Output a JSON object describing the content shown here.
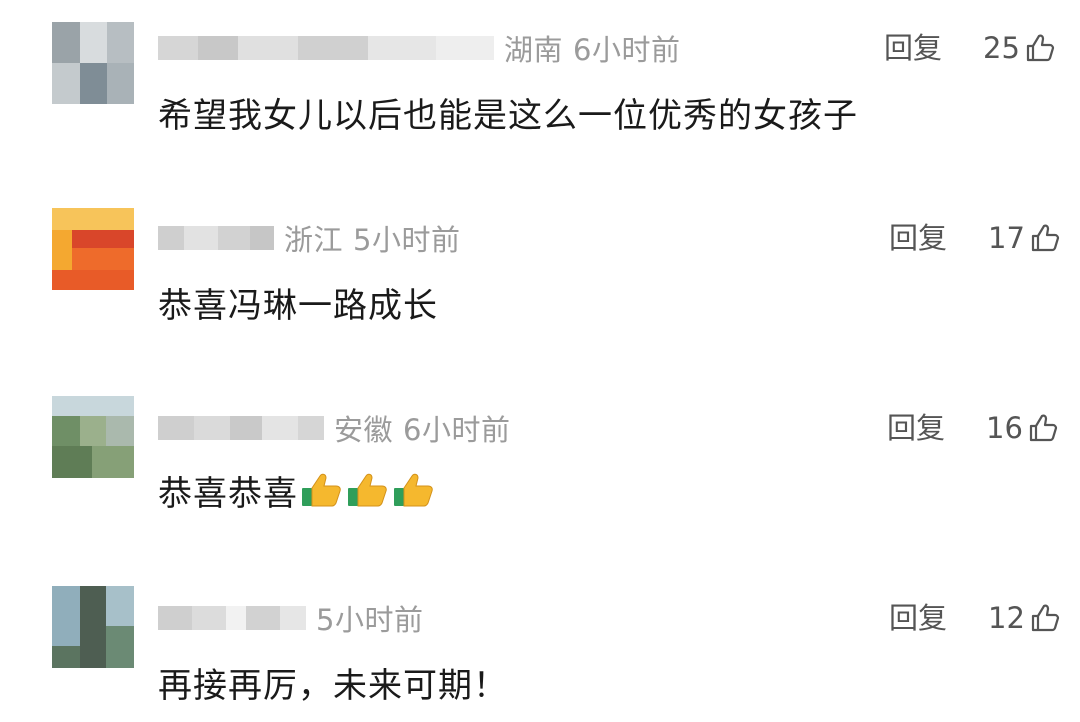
{
  "comments": [
    {
      "location": "湖南",
      "time": "6小时前",
      "reply_label": "回复",
      "likes": "25",
      "text": "希望我女儿以后也能是这么一位优秀的女孩子",
      "emoji_count": 0,
      "like_icon": "thumb-up-outline-icon"
    },
    {
      "location": "浙江",
      "time": "5小时前",
      "reply_label": "回复",
      "likes": "17",
      "text": "恭喜冯琳一路成长",
      "emoji_count": 0,
      "like_icon": "thumb-up-outline-icon"
    },
    {
      "location": "安徽",
      "time": "6小时前",
      "reply_label": "回复",
      "likes": "16",
      "text": "恭喜恭喜",
      "emoji_count": 3,
      "emoji": "thumbs-up-emoji",
      "like_icon": "thumb-up-outline-icon"
    },
    {
      "location": "",
      "time": "5小时前",
      "reply_label": "回复",
      "likes": "12",
      "text": "再接再厉，未来可期！",
      "emoji_count": 0,
      "like_icon": "thumb-up-outline-icon"
    }
  ],
  "colors": {
    "meta_gray": "#9b9b9b",
    "action_gray": "#555555",
    "text_black": "#1a1a1a",
    "background": "#ffffff"
  }
}
